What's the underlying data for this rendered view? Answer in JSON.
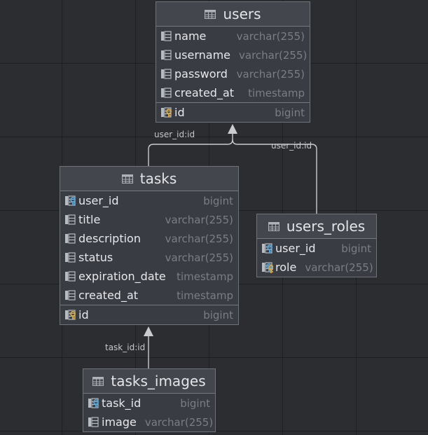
{
  "tables": [
    {
      "id": "users",
      "name": "users",
      "columns": [
        {
          "name": "name",
          "type": "varchar(255)",
          "icon": "column-icon"
        },
        {
          "name": "username",
          "type": "varchar(255)",
          "icon": "column-icon"
        },
        {
          "name": "password",
          "type": "varchar(255)",
          "icon": "column-icon"
        },
        {
          "name": "created_at",
          "type": "timestamp",
          "icon": "column-icon"
        }
      ],
      "keys": [
        {
          "name": "id",
          "type": "bigint",
          "icon": "primary-key-icon"
        }
      ]
    },
    {
      "id": "tasks",
      "name": "tasks",
      "columns": [
        {
          "name": "user_id",
          "type": "bigint",
          "icon": "foreign-key-icon"
        },
        {
          "name": "title",
          "type": "varchar(255)",
          "icon": "column-icon"
        },
        {
          "name": "description",
          "type": "varchar(255)",
          "icon": "column-icon"
        },
        {
          "name": "status",
          "type": "varchar(255)",
          "icon": "column-icon"
        },
        {
          "name": "expiration_date",
          "type": "timestamp",
          "icon": "column-icon"
        },
        {
          "name": "created_at",
          "type": "timestamp",
          "icon": "column-icon"
        }
      ],
      "keys": [
        {
          "name": "id",
          "type": "bigint",
          "icon": "primary-key-icon"
        }
      ]
    },
    {
      "id": "users_roles",
      "name": "users_roles",
      "columns": [
        {
          "name": "user_id",
          "type": "bigint",
          "icon": "foreign-key-icon"
        },
        {
          "name": "role",
          "type": "varchar(255)",
          "icon": "primary-foreign-key-icon"
        }
      ],
      "keys": []
    },
    {
      "id": "tasks_images",
      "name": "tasks_images",
      "columns": [
        {
          "name": "task_id",
          "type": "bigint",
          "icon": "foreign-key-icon"
        },
        {
          "name": "image",
          "type": "varchar(255)",
          "icon": "column-icon"
        }
      ],
      "keys": []
    }
  ],
  "relations": [
    {
      "label": "user_id:id",
      "from": "tasks",
      "to": "users"
    },
    {
      "label": "user_id:id",
      "from": "users_roles",
      "to": "users"
    },
    {
      "label": "task_id:id",
      "from": "tasks_images",
      "to": "tasks"
    }
  ],
  "colors": {
    "canvas": "#2b2d30",
    "table_body": "#393c42",
    "table_header": "#43464c",
    "border": "#6e7279",
    "text": "#e6e8eb",
    "type_text": "#7a7e85",
    "connector": "#c9cbcf",
    "column_icon": "#b7bbc2",
    "key_gold": "#d8a53a",
    "key_blue": "#4aa3d9"
  }
}
